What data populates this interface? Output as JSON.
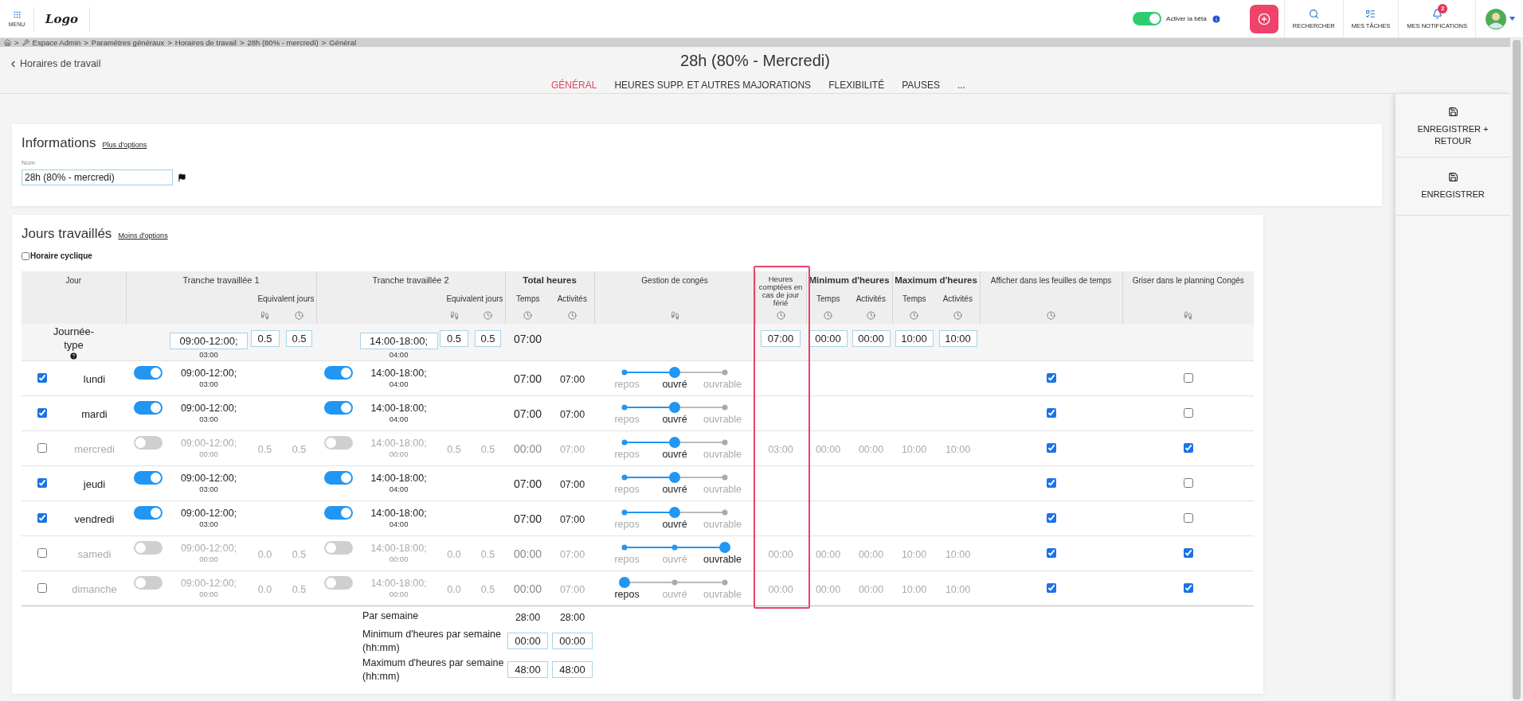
{
  "topbar": {
    "menu_label": "MENU",
    "logo": "Logo",
    "beta": {
      "label": "Activer la bêta",
      "on": true
    },
    "actions": [
      {
        "kind": "search",
        "label": "RECHERCHER"
      },
      {
        "kind": "tasks",
        "label": "MES TÂCHES"
      },
      {
        "kind": "notifications",
        "label": "MES NOTIFICATIONS",
        "badge": "2"
      }
    ]
  },
  "breadcrumb": {
    "separator": ">",
    "items": [
      "Espace Admin",
      "Paramètres généraux",
      "Horaires de travail",
      "28h (80% - mercredi)",
      "Général"
    ]
  },
  "back_link": "Horaires de travail",
  "title": "28h (80% - Mercredi)",
  "tabs": [
    {
      "label": "GÉNÉRAL",
      "selected": true
    },
    {
      "label": "HEURES SUPP. ET AUTRES MAJORATIONS",
      "selected": false
    },
    {
      "label": "FLEXIBILITÉ",
      "selected": false
    },
    {
      "label": "PAUSES",
      "selected": false
    },
    {
      "label": "...",
      "selected": false
    }
  ],
  "sidebar": [
    {
      "kind": "save_return",
      "label": "ENREGISTRER + RETOUR"
    },
    {
      "kind": "save",
      "label": "ENREGISTRER"
    }
  ],
  "informations": {
    "title": "Informations",
    "link": "Plus d'options",
    "name_label": "Nom",
    "name_value": "28h (80% - mercredi)"
  },
  "jours": {
    "title": "Jours travaillés",
    "link": "Moins d'options",
    "cyclic": {
      "label": "Horaire cyclique",
      "checked": false
    },
    "groups": [
      {
        "kind": "day",
        "title": "Jour"
      },
      {
        "kind": "slot",
        "title": "Tranche travaillée 1",
        "sub": "Equivalent jours"
      },
      {
        "kind": "slot",
        "title": "Tranche travaillée 2",
        "sub": "Equivalent jours"
      },
      {
        "kind": "pair",
        "title": "Total heures",
        "subs": [
          "Temps",
          "Activités"
        ]
      },
      {
        "kind": "leave",
        "title": "Gestion de congés"
      },
      {
        "kind": "holiday",
        "title": "Heures comptées en cas de jour férié"
      },
      {
        "kind": "pair",
        "title": "Minimum d'heures",
        "subs": [
          "Temps",
          "Activités"
        ]
      },
      {
        "kind": "pair",
        "title": "Maximum d'heures",
        "subs": [
          "Temps",
          "Activités"
        ]
      },
      {
        "kind": "timesheet",
        "title": "Afficher dans les feuilles de temps"
      },
      {
        "kind": "planning",
        "title": "Griser dans le planning Congés"
      }
    ],
    "typical_day": {
      "label": "Journée-type",
      "slot1": {
        "time": "09:00-12:00;",
        "duration": "03:00",
        "equiv": [
          "0.5",
          "0.5"
        ]
      },
      "slot2": {
        "time": "14:00-18:00;",
        "duration": "04:00",
        "equiv": [
          "0.5",
          "0.5"
        ]
      },
      "total": "07:00",
      "holiday": "07:00",
      "min": [
        "00:00",
        "00:00"
      ],
      "max": [
        "10:00",
        "10:00"
      ]
    },
    "days": [
      {
        "checked": true,
        "name": "lundi",
        "slot1": {
          "on": true,
          "time": "09:00-12:00;",
          "duration": "03:00"
        },
        "slot2": {
          "on": true,
          "time": "14:00-18:00;",
          "duration": "04:00"
        },
        "total": [
          "07:00",
          "07:00"
        ],
        "leave": [
          {
            "label": "repos",
            "selected": false
          },
          {
            "label": "ouvré",
            "selected": true
          },
          {
            "label": "ouvrable",
            "selected": false
          }
        ],
        "level": 0.5,
        "timesheet": true,
        "planning": false
      },
      {
        "checked": true,
        "name": "mardi",
        "slot1": {
          "on": true,
          "time": "09:00-12:00;",
          "duration": "03:00"
        },
        "slot2": {
          "on": true,
          "time": "14:00-18:00;",
          "duration": "04:00"
        },
        "total": [
          "07:00",
          "07:00"
        ],
        "leave": [
          {
            "label": "repos",
            "selected": false
          },
          {
            "label": "ouvré",
            "selected": true
          },
          {
            "label": "ouvrable",
            "selected": false
          }
        ],
        "level": 0.5,
        "timesheet": true,
        "planning": false
      },
      {
        "checked": false,
        "name": "mercredi",
        "slot1": {
          "on": false,
          "time": "09:00-12:00;",
          "duration": "00:00",
          "equiv": [
            "0.5",
            "0.5"
          ]
        },
        "slot2": {
          "on": false,
          "time": "14:00-18:00;",
          "duration": "00:00",
          "equiv": [
            "0.5",
            "0.5"
          ]
        },
        "total": [
          "00:00",
          "07:00"
        ],
        "leave": [
          {
            "label": "repos",
            "selected": false
          },
          {
            "label": "ouvré",
            "selected": true
          },
          {
            "label": "ouvrable",
            "selected": false
          }
        ],
        "level": 0.5,
        "holiday": "03:00",
        "min": [
          "00:00",
          "00:00"
        ],
        "max": [
          "10:00",
          "10:00"
        ],
        "timesheet": true,
        "planning": true
      },
      {
        "checked": true,
        "name": "jeudi",
        "slot1": {
          "on": true,
          "time": "09:00-12:00;",
          "duration": "03:00"
        },
        "slot2": {
          "on": true,
          "time": "14:00-18:00;",
          "duration": "04:00"
        },
        "total": [
          "07:00",
          "07:00"
        ],
        "leave": [
          {
            "label": "repos",
            "selected": false
          },
          {
            "label": "ouvré",
            "selected": true
          },
          {
            "label": "ouvrable",
            "selected": false
          }
        ],
        "level": 0.5,
        "timesheet": true,
        "planning": false
      },
      {
        "checked": true,
        "name": "vendredi",
        "slot1": {
          "on": true,
          "time": "09:00-12:00;",
          "duration": "03:00"
        },
        "slot2": {
          "on": true,
          "time": "14:00-18:00;",
          "duration": "04:00"
        },
        "total": [
          "07:00",
          "07:00"
        ],
        "leave": [
          {
            "label": "repos",
            "selected": false
          },
          {
            "label": "ouvré",
            "selected": true
          },
          {
            "label": "ouvrable",
            "selected": false
          }
        ],
        "level": 0.5,
        "timesheet": true,
        "planning": false
      },
      {
        "checked": false,
        "name": "samedi",
        "slot1": {
          "on": false,
          "time": "09:00-12:00;",
          "duration": "00:00",
          "equiv": [
            "0.0",
            "0.5"
          ]
        },
        "slot2": {
          "on": false,
          "time": "14:00-18:00;",
          "duration": "00:00",
          "equiv": [
            "0.0",
            "0.5"
          ]
        },
        "total": [
          "00:00",
          "07:00"
        ],
        "leave": [
          {
            "label": "repos",
            "selected": false
          },
          {
            "label": "ouvré",
            "selected": false
          },
          {
            "label": "ouvrable",
            "selected": true
          }
        ],
        "level": 1,
        "holiday": "00:00",
        "min": [
          "00:00",
          "00:00"
        ],
        "max": [
          "10:00",
          "10:00"
        ],
        "timesheet": true,
        "planning": true
      },
      {
        "checked": false,
        "name": "dimanche",
        "slot1": {
          "on": false,
          "time": "09:00-12:00;",
          "duration": "00:00",
          "equiv": [
            "0.0",
            "0.5"
          ]
        },
        "slot2": {
          "on": false,
          "time": "14:00-18:00;",
          "duration": "00:00",
          "equiv": [
            "0.0",
            "0.5"
          ]
        },
        "total": [
          "00:00",
          "07:00"
        ],
        "leave": [
          {
            "label": "repos",
            "selected": true
          },
          {
            "label": "ouvré",
            "selected": false
          },
          {
            "label": "ouvrable",
            "selected": false
          }
        ],
        "level": 0,
        "holiday": "00:00",
        "min": [
          "00:00",
          "00:00"
        ],
        "max": [
          "10:00",
          "10:00"
        ],
        "timesheet": true,
        "planning": true
      }
    ],
    "weekly": [
      {
        "kind": "text",
        "label": "Par semaine",
        "values": [
          "28:00",
          "28:00"
        ]
      },
      {
        "kind": "field",
        "label": "Minimum d'heures par semaine (hh:mm)",
        "values": [
          "00:00",
          "00:00"
        ]
      },
      {
        "kind": "field",
        "label": "Maximum d'heures par semaine (hh:mm)",
        "values": [
          "48:00",
          "48:00"
        ]
      }
    ]
  }
}
